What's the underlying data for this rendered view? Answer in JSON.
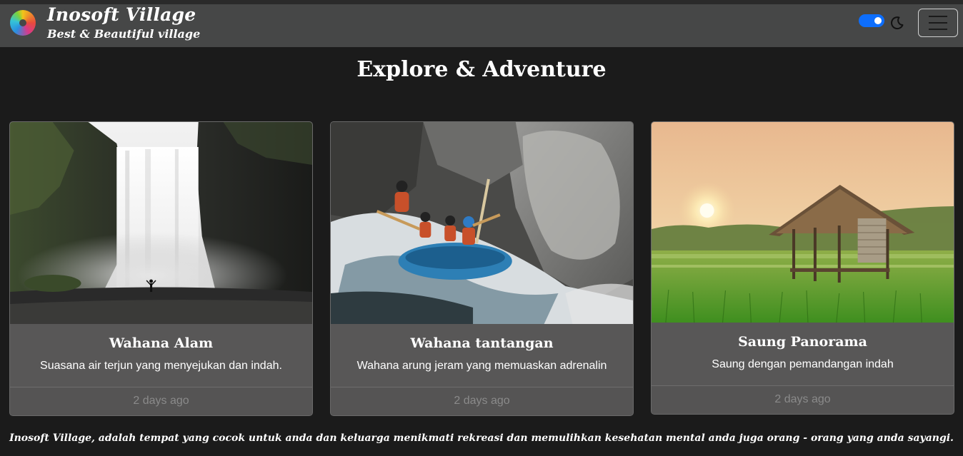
{
  "brand": {
    "title": "Inosoft Village",
    "subtitle": "Best & Beautiful village",
    "logo_icon": "logo-icon"
  },
  "navbar": {
    "theme_toggle_on": true,
    "theme_icon": "moon-icon",
    "menu_icon": "hamburger-icon",
    "accent_color": "#0d6efd"
  },
  "section": {
    "title": "Explore & Adventure"
  },
  "cards": [
    {
      "image": "waterfall-photo",
      "title": "Wahana Alam",
      "text": "Suasana air terjun yang menyejukan dan indah.",
      "footer": "2 days ago"
    },
    {
      "image": "rafting-photo",
      "title": "Wahana tantangan",
      "text": "Wahana arung jeram yang memuaskan adrenalin",
      "footer": "2 days ago"
    },
    {
      "image": "rice-field-hut-photo",
      "title": "Saung Panorama",
      "text": "Saung dengan pemandangan indah",
      "footer": "2 days ago"
    }
  ],
  "footer": {
    "text": "Inosoft Village, adalah tempat yang cocok untuk anda dan keluarga menikmati rekreasi dan memulihkan kesehatan mental anda juga orang - orang yang anda sayangi."
  }
}
